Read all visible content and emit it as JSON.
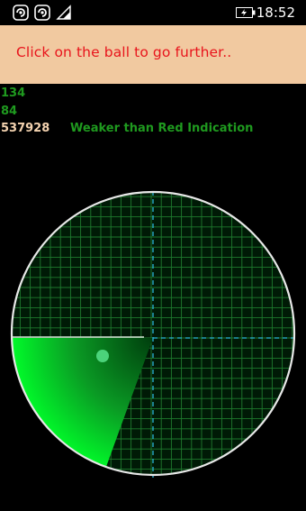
{
  "status_bar": {
    "time": "18:52",
    "icons": [
      "notification-swirl-icon",
      "notification-swirl-icon",
      "wifi-icon",
      "battery-charging-icon"
    ]
  },
  "banner": {
    "message": "Click on the ball to go further..",
    "background": "#f1c9a0",
    "text_color": "#e8141c"
  },
  "readings": {
    "first": "134",
    "second": "84",
    "third": "537928",
    "signal_label": "Weaker than Red Indication"
  },
  "radar": {
    "grid_color": "#1e7a2e",
    "axis_color": "#2bb6d9",
    "sweep_color": "#00ff2a",
    "sweep_start_angle_deg": 180,
    "sweep_end_angle_deg": 250,
    "ball_color": "#4bd37a"
  }
}
